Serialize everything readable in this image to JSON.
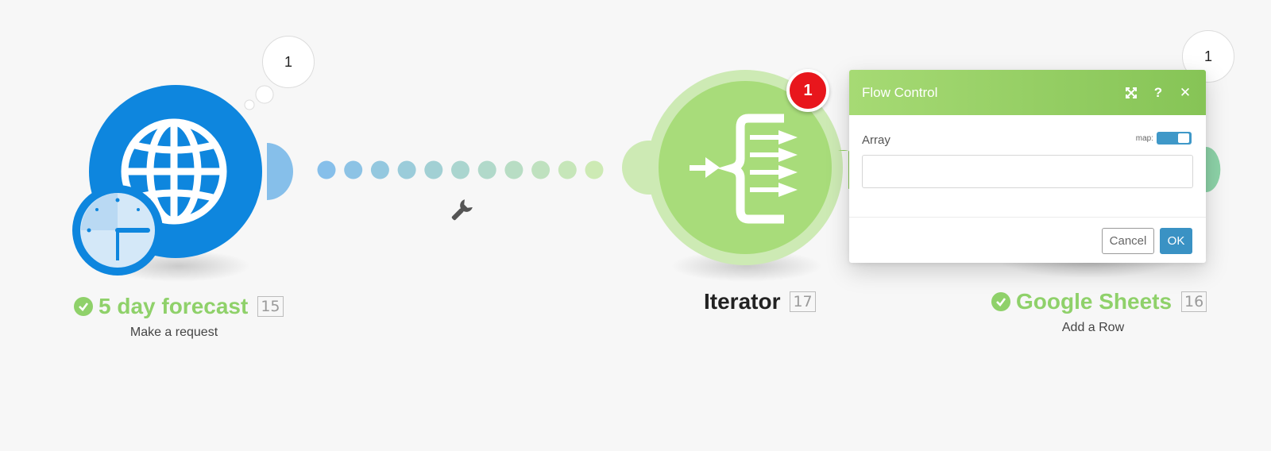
{
  "modules": {
    "http": {
      "title": "5 day forecast",
      "number": "15",
      "subtitle": "Make a request",
      "bubble_count": "1",
      "icon": "globe-icon",
      "schedule_icon": "clock-icon",
      "title_color": "#8fd16a",
      "color": "#0e86de"
    },
    "iterator": {
      "title": "Iterator",
      "number": "17",
      "badge": "1",
      "icon": "iterator-icon",
      "color": "#a8dc7a"
    },
    "sheets": {
      "title": "Google Sheets",
      "number": "16",
      "subtitle": "Add a Row",
      "bubble_count": "1",
      "title_color": "#8fd16a"
    }
  },
  "connection": {
    "tool_icon": "wrench-icon"
  },
  "dialog": {
    "title": "Flow Control",
    "field_label": "Array",
    "map_label": "map:",
    "input_value": "",
    "cancel_label": "Cancel",
    "ok_label": "OK",
    "expand_icon": "expand-icon",
    "help_icon": "help-icon",
    "close_icon": "close-icon",
    "header_color": "#8cc85c",
    "ok_color": "#3a92c4"
  }
}
